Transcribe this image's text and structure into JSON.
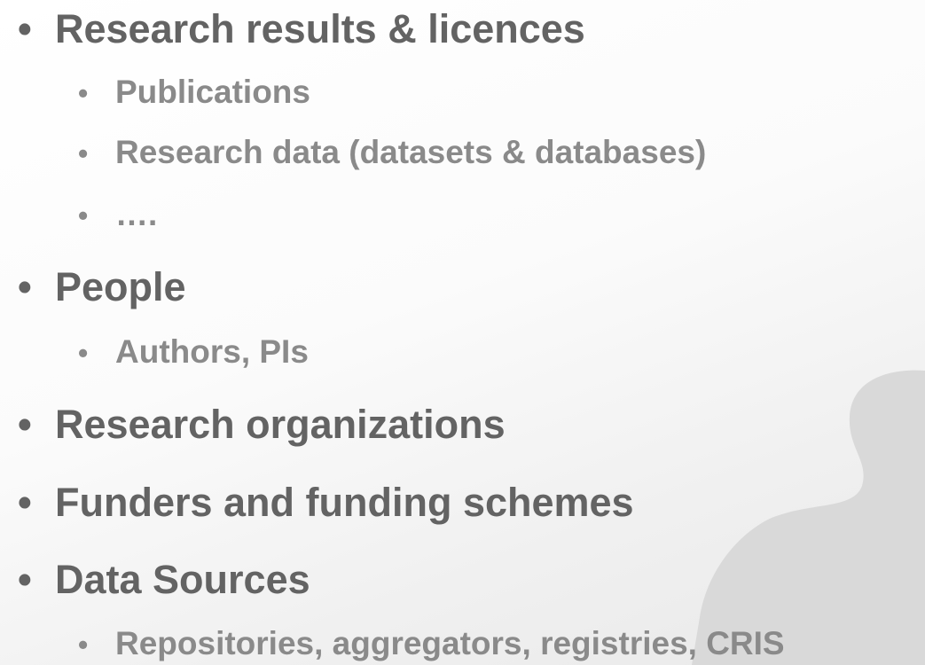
{
  "slide": {
    "items": [
      {
        "level": 1,
        "text": "Research results & licences"
      },
      {
        "level": 2,
        "text": "Publications"
      },
      {
        "level": 2,
        "text": "Research data (datasets & databases)"
      },
      {
        "level": 2,
        "text": "…."
      },
      {
        "level": 1,
        "text": "People"
      },
      {
        "level": 2,
        "text": "Authors, PIs"
      },
      {
        "level": 1,
        "text": "Research organizations"
      },
      {
        "level": 1,
        "text": "Funders and funding schemes"
      },
      {
        "level": 1,
        "text": "Data Sources"
      },
      {
        "level": 2,
        "text": "Repositories, aggregators, registries, CRIS"
      }
    ],
    "bullet_glyph": "•"
  },
  "colors": {
    "level1_text": "#636363",
    "level2_text": "#8a8a8a",
    "decoration": "#d9d9d9"
  }
}
